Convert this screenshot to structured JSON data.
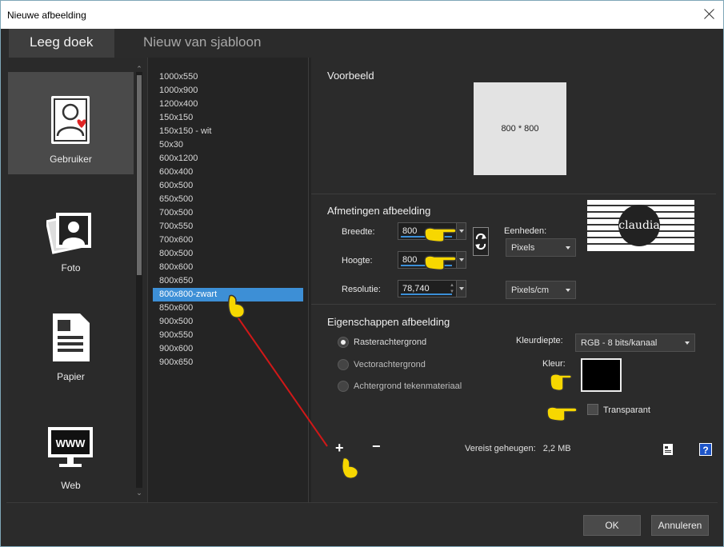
{
  "window": {
    "title": "Nieuwe afbeelding"
  },
  "tabs": [
    {
      "label": "Leeg doek"
    },
    {
      "label": "Nieuw van sjabloon"
    }
  ],
  "sidebar": {
    "items": [
      {
        "label": "Gebruiker",
        "icon": "user-heart-icon"
      },
      {
        "label": "Foto",
        "icon": "photo-icon"
      },
      {
        "label": "Papier",
        "icon": "document-icon"
      },
      {
        "label": "Web",
        "icon": "www-monitor-icon"
      }
    ]
  },
  "templates": {
    "items": [
      "1000x550",
      "1000x900",
      "1200x400",
      "150x150",
      "150x150 - wit",
      "50x30",
      "600x1200",
      "600x400",
      "600x500",
      "650x500",
      "700x500",
      "700x550",
      "700x600",
      "800x500",
      "800x600",
      "800x650",
      "800x800-zwart",
      "850x600",
      "900x500",
      "900x550",
      "900x600",
      "900x650"
    ],
    "selected": "800x800-zwart"
  },
  "preview": {
    "title": "Voorbeeld",
    "text": "800 * 800"
  },
  "dimensions": {
    "title": "Afmetingen afbeelding",
    "width_label": "Breedte:",
    "width_value": "800",
    "height_label": "Hoogte:",
    "height_value": "800",
    "resolution_label": "Resolutie:",
    "resolution_value": "78,740",
    "units_label": "Eenheden:",
    "units_value": "Pixels",
    "res_units_value": "Pixels/cm"
  },
  "logo": {
    "text": "claudia"
  },
  "properties": {
    "title": "Eigenschappen afbeelding",
    "radios": [
      {
        "label": "Rasterachtergrond",
        "selected": true
      },
      {
        "label": "Vectorachtergrond",
        "selected": false
      },
      {
        "label": "Achtergrond tekenmateriaal",
        "selected": false
      }
    ],
    "color_depth_label": "Kleurdiepte:",
    "color_depth_value": "RGB - 8 bits/kanaal",
    "color_label": "Kleur:",
    "color_value": "#000000",
    "transparent_label": "Transparant"
  },
  "memory": {
    "label": "Vereist geheugen:",
    "value": "2,2 MB"
  },
  "footer": {
    "ok_label": "OK",
    "cancel_label": "Annuleren"
  },
  "colors": {
    "accent": "#3d8fd6",
    "hand": "#f7d700"
  }
}
